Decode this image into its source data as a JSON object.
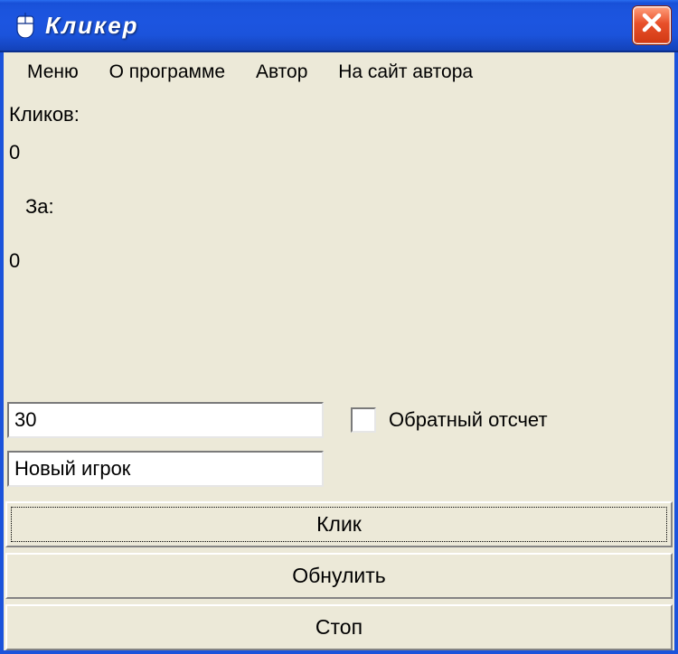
{
  "window": {
    "title": "Кликер"
  },
  "menu": {
    "items": [
      "Меню",
      "О программе",
      "Автор",
      "На сайт автора"
    ]
  },
  "stats": {
    "clicks_label": "Кликов:",
    "clicks_value": "0",
    "time_label": "За:",
    "time_value": "0"
  },
  "inputs": {
    "duration": "30",
    "player_name": "Новый игрок"
  },
  "checkbox": {
    "countdown_label": "Обратный отсчет",
    "countdown_checked": false
  },
  "buttons": {
    "click": "Клик",
    "reset": "Обнулить",
    "stop": "Стоп"
  },
  "icons": {
    "app": "mouse-icon",
    "close": "close-icon"
  },
  "colors": {
    "titlebar": "#1b53db",
    "close": "#d84315",
    "face": "#ece9d8"
  }
}
